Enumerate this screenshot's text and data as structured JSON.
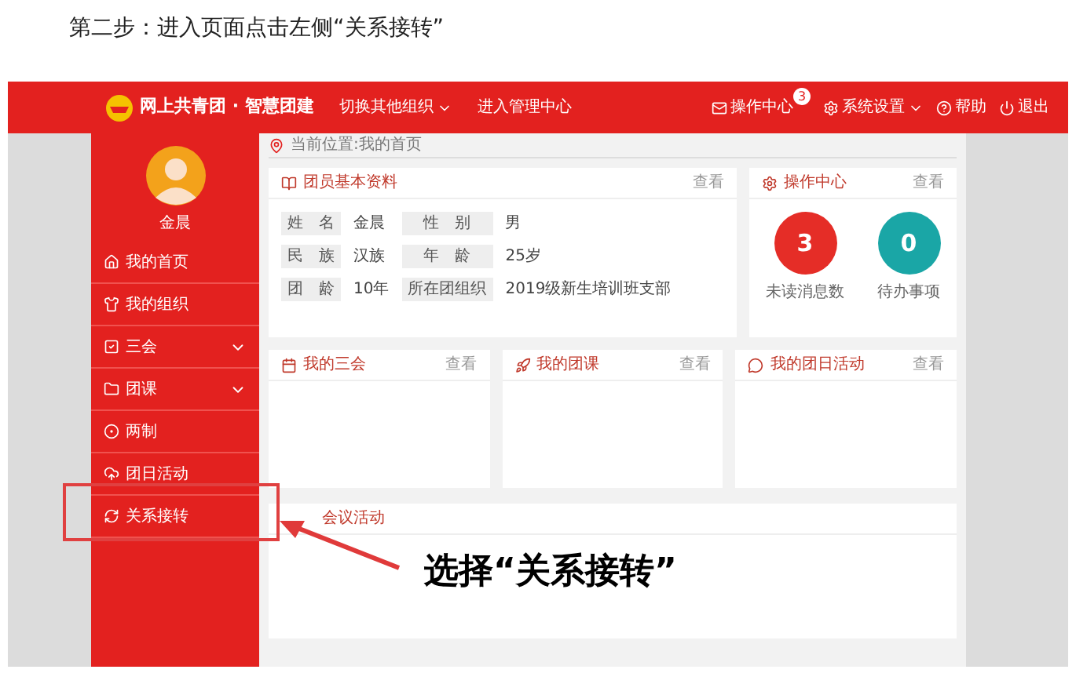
{
  "caption": "第二步：进入页面点击左侧“关系接转”",
  "header": {
    "logo_text": "网上共青团 · 智慧团建",
    "nav": [
      {
        "label": "切换其他组织",
        "dropdown": true
      },
      {
        "label": "进入管理中心",
        "dropdown": false
      }
    ],
    "right": [
      {
        "kind": "mail",
        "label": "操作中心",
        "badge": "3",
        "dropdown": false
      },
      {
        "kind": "settings",
        "label": "系统设置",
        "dropdown": true
      },
      {
        "kind": "help",
        "label": "帮助",
        "dropdown": false
      },
      {
        "kind": "power",
        "label": "退出",
        "dropdown": false
      }
    ]
  },
  "sidebar": {
    "user_name": "金晨",
    "items": [
      {
        "kind": "home",
        "label": "我的首页",
        "has_submenu": false
      },
      {
        "kind": "shirt",
        "label": "我的组织",
        "has_submenu": false
      },
      {
        "kind": "check",
        "label": "三会",
        "has_submenu": true
      },
      {
        "kind": "folder",
        "label": "团课",
        "has_submenu": true
      },
      {
        "kind": "target",
        "label": "两制",
        "has_submenu": false
      },
      {
        "kind": "cloud",
        "label": "团日活动",
        "has_submenu": false
      },
      {
        "kind": "refresh",
        "label": "关系接转",
        "has_submenu": false
      }
    ]
  },
  "breadcrumb": "当前位置:我的首页",
  "profile_card": {
    "title": "团员基本资料",
    "link": "查看",
    "fields": [
      {
        "label": "姓　名",
        "value": "金晨"
      },
      {
        "label": "性　别",
        "value": "男"
      },
      {
        "label": "民　族",
        "value": "汉族"
      },
      {
        "label": "年　龄",
        "value": "25岁"
      },
      {
        "label": "团　龄",
        "value": "10年"
      },
      {
        "label": "所在团组织",
        "value": "2019级新生培训班支部"
      }
    ]
  },
  "ops_card": {
    "title": "操作中心",
    "link": "查看",
    "stats": [
      {
        "value": "3",
        "label": "未读消息数",
        "color": "#e52d27"
      },
      {
        "value": "0",
        "label": "待办事项",
        "color": "#1aa6a6"
      }
    ]
  },
  "cards": [
    {
      "kind": "meeting",
      "title": "我的三会",
      "link": "查看"
    },
    {
      "kind": "course",
      "title": "我的团课",
      "link": "查看"
    },
    {
      "kind": "activity",
      "title": "我的团日活动",
      "link": "查看"
    }
  ],
  "activity_card": {
    "title": "会议活动"
  },
  "annotation": {
    "text": "选择“关系接转”"
  }
}
